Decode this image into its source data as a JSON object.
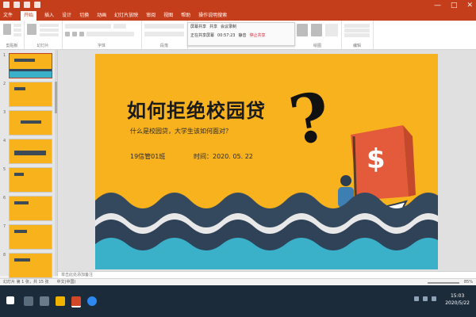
{
  "ribbon": {
    "tabs": [
      "文件",
      "开始",
      "插入",
      "设计",
      "切换",
      "动画",
      "幻灯片放映",
      "审阅",
      "视图",
      "帮助"
    ],
    "active_tab": "开始",
    "tell_me": "操作说明搜索",
    "groups": [
      "剪贴板",
      "幻灯片",
      "字体",
      "段落",
      "绘图",
      "编辑"
    ]
  },
  "window_controls": {
    "minimize": "—",
    "maximize": "□",
    "close": "✕"
  },
  "meeting_bar": {
    "row1": [
      "屏幕共享",
      "共享",
      "会议录制"
    ],
    "row2": [
      "正在共享屏幕",
      "00:57:23",
      "静音",
      "停止共享"
    ]
  },
  "slide_panel": {
    "numbers": [
      "1",
      "2",
      "3",
      "4",
      "5",
      "6",
      "7",
      "8"
    ]
  },
  "slide": {
    "title": "如何拒绝校园贷",
    "subtitle": "什么是校园贷，大学生该如何面对？",
    "class_label": "19信管01班",
    "time_label": "时间：2020. 05. 22",
    "question_mark": "?",
    "sail_symbol": "$"
  },
  "notes_placeholder": "单击此处添加备注",
  "status": {
    "left": [
      "幻灯片 第 1 张，共 15 张",
      "中文(中国)"
    ],
    "zoom": "85%"
  },
  "taskbar": {
    "time": "15:03",
    "date": "2020/5/22"
  },
  "colors": {
    "accent": "#c43e1c",
    "slide_bg": "#f8b21e",
    "wave_dark": "#34495e",
    "wave_teal": "#3bb0c9"
  }
}
